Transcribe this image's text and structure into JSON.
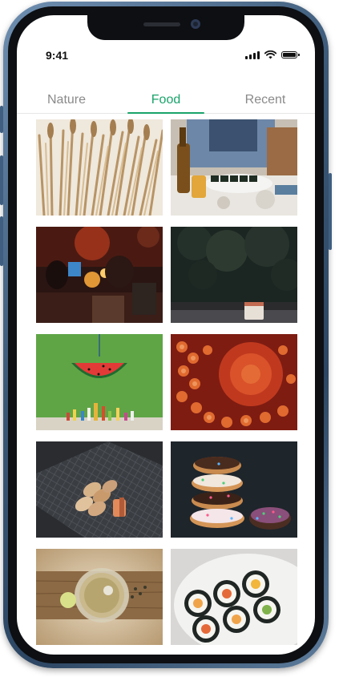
{
  "status_bar": {
    "time": "9:41"
  },
  "tabs": [
    {
      "label": "Nature",
      "active": false
    },
    {
      "label": "Food",
      "active": true
    },
    {
      "label": "Recent",
      "active": false
    }
  ],
  "accent_color": "#1aa36a",
  "photos": [
    "wheat-bundle",
    "sushi-dinner-table",
    "restaurant-night-candles",
    "coffee-cup-dark-garden",
    "watermelon-pinata-green-wall",
    "octopus-tentacles",
    "cookies-on-grill-mat",
    "stacked-donuts",
    "cocktail-on-wood-board",
    "sushi-rolls-plate"
  ]
}
